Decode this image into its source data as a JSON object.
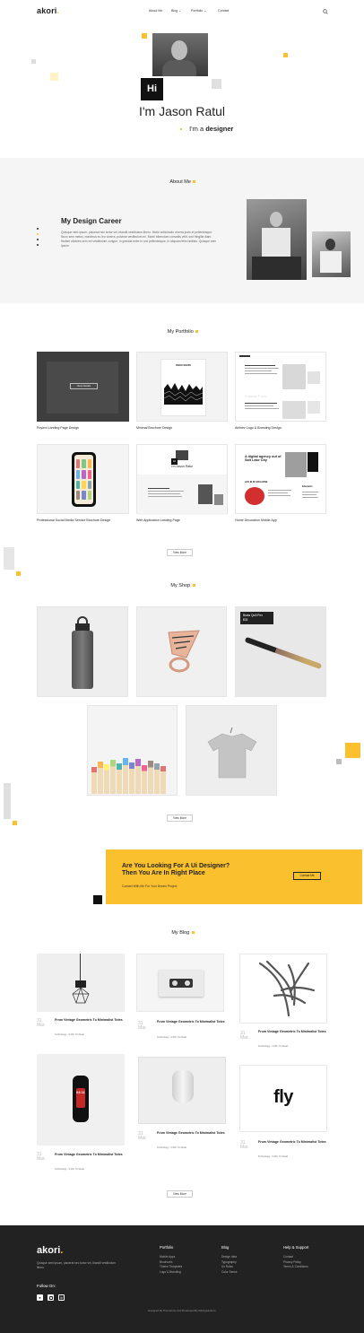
{
  "nav": {
    "logo": "akori",
    "links": [
      "About Me",
      "Blog",
      "Portfolio",
      "Contact"
    ],
    "search_icon": "search-icon"
  },
  "hero": {
    "hi": "Hi",
    "name": "I'm Jason Ratul",
    "role_prefix": "I'm a",
    "role": "designer"
  },
  "about": {
    "section_title": "About Me",
    "heading": "My Design Career",
    "body": "Quisque sem ipsum, placerat nec tortor vel, blandit vestibulum libero. Morbi sollicitudin viverra justo et pellentesque. Nunc sem metus, maximus eu leo viverra, pulvinar vestibulum mi. Morbi bibendum convallis velit, sed fringilla diam. Nullam ultricies sem vel vestibulum congue. In gravida enim in orci pellentesque, in aliquam felis facilisis. Quisque sem ipsum"
  },
  "portfolio": {
    "section_title": "My Portfolio",
    "view_details": "View Details",
    "items": [
      "Poylexi Landing Page Design",
      "Minimal Brochure Design",
      "Airlinez Logo & Branding Design",
      "Professional Social Media Service Brochure Design",
      "Web Application Landing Page",
      "Home Decoration Mobile App"
    ],
    "view_more": "View More",
    "thumb_texts": {
      "brochure": "RADIO WAVES",
      "mini_name": "I'm Jason Ratul",
      "mini_hi": "Hi",
      "app_heading": "A digital agency out of Salt Lake City",
      "app_sub": "LIFE IN SF MAGAZINE",
      "app_side": "Education",
      "popular": "Popular Posts"
    }
  },
  "shop": {
    "section_title": "My Shop",
    "product_label": "Brass Quill Pen",
    "product_price": "$33",
    "view_more": "View More"
  },
  "cta": {
    "heading_line1": "Are You Looking For A Ui Designer?",
    "heading_line2": "Then You Are In Right Place",
    "sub": "Contact With Me For Your Dream Project",
    "button": "Contact Me"
  },
  "blog": {
    "section_title": "My Blog",
    "posts": [
      {
        "day": "31",
        "month": "Mar.",
        "title": "From Vintage Geometric To Minimalist Totes",
        "meta": "Technology  -  3 Min. To Read"
      },
      {
        "day": "31",
        "month": "Mar.",
        "title": "From Vintage Geometric To Minimalist Totes",
        "meta": "Technology  -  3 Min. To Read"
      },
      {
        "day": "31",
        "month": "Mar.",
        "title": "From Vintage Geometric To Minimalist Totes",
        "meta": "Technology  -  3 Min. To Read"
      },
      {
        "day": "31",
        "month": "Mar.",
        "title": "From Vintage Geometric To Minimalist Totes",
        "meta": "Technology  -  3 Min. To Read"
      },
      {
        "day": "31",
        "month": "Mar.",
        "title": "From Vintage Geometric To Minimalist Totes",
        "meta": "Technology  -  3 Min. To Read"
      },
      {
        "day": "31",
        "month": "Mar.",
        "title": "From Vintage Geometric To Minimalist Totes",
        "meta": "Technology  -  3 Min. To Read"
      }
    ],
    "fly_logo": "fly",
    "watch_time": "04 11",
    "view_more": "View More"
  },
  "footer": {
    "logo": "akori",
    "desc": "Quisque sem ipsum, placerat nec tortor vel, blandit vestibulum libero.",
    "follow": "Follow On:",
    "social_icons": [
      "twitter-icon",
      "instagram-icon",
      "dribbble-icon"
    ],
    "cols": [
      {
        "title": "Portfolio",
        "links": [
          "Mobile Apps",
          "Brochures",
          "Theme Templates",
          "Logo & Branding"
        ]
      },
      {
        "title": "Blog",
        "links": [
          "Design Idea",
          "Typography",
          "Ux Rules",
          "Color Sense"
        ]
      },
      {
        "title": "Help & Support",
        "links": [
          "Contact",
          "Privacy Policy",
          "Terms & Conditions"
        ]
      }
    ],
    "copyright": "Designed By Themeforce And Developed By Ibthingsolutions"
  },
  "colors": {
    "accent": "#fbc02d",
    "dark": "#222222",
    "light": "#f5f5f5"
  }
}
